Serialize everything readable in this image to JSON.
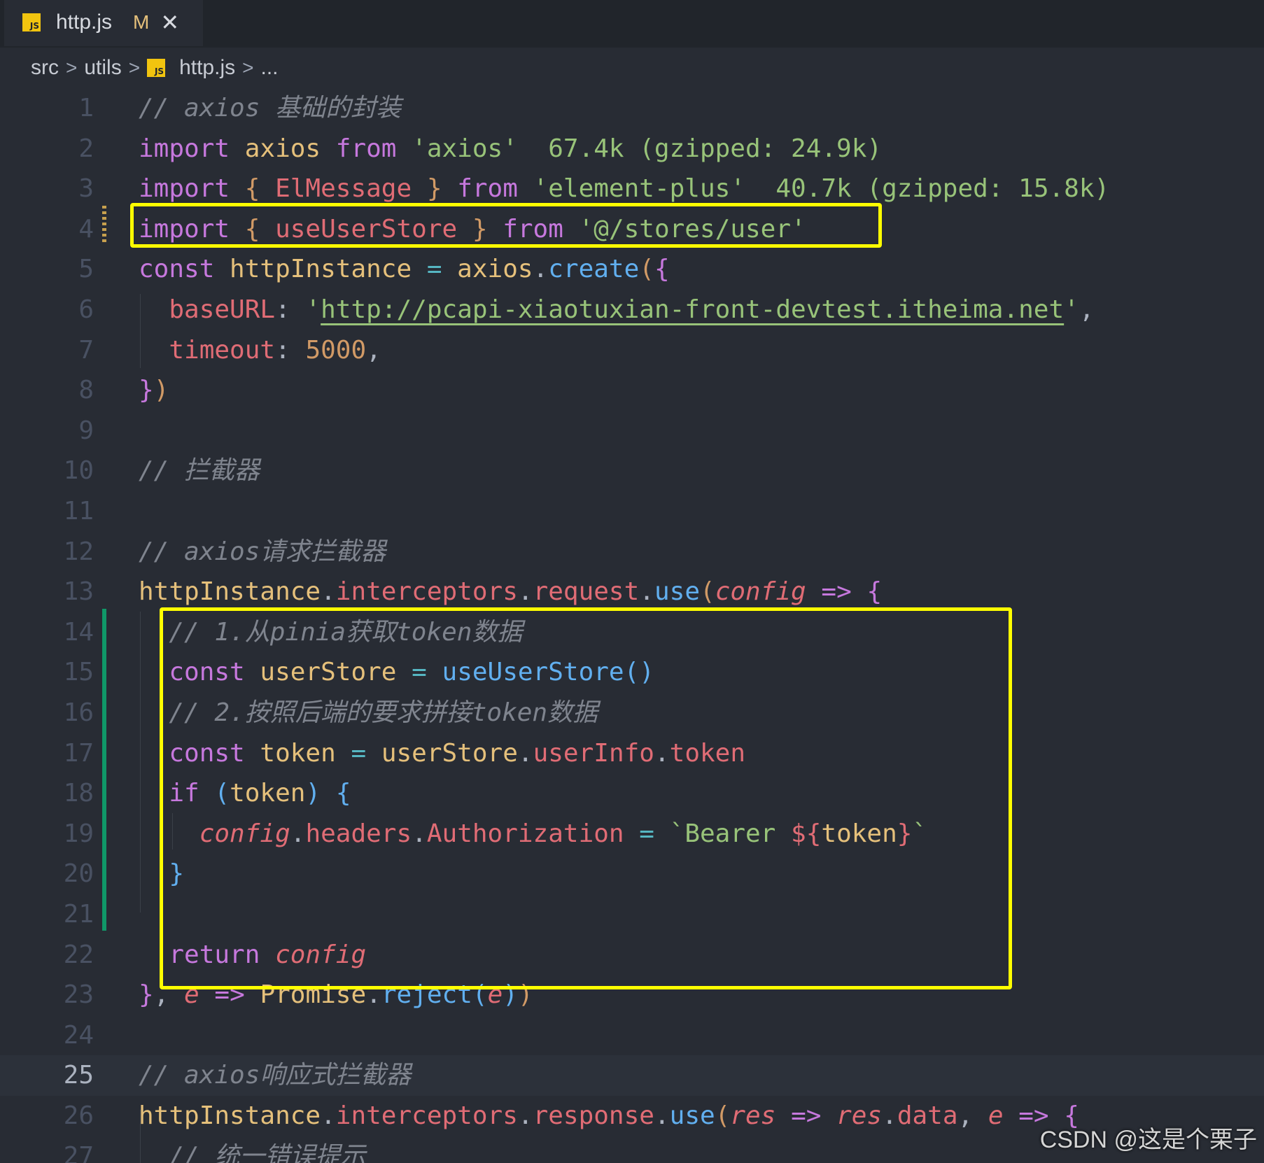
{
  "tab": {
    "icon": "js-file-icon",
    "icon_label": "JS",
    "filename": "http.js",
    "status": "M",
    "close_glyph": "✕"
  },
  "breadcrumb": {
    "items": [
      "src",
      "utils",
      "http.js",
      "..."
    ],
    "separator": ">",
    "file_icon_label": "JS"
  },
  "editor": {
    "current_line": 25,
    "lines": [
      {
        "n": "1",
        "tokens": [
          [
            "cm",
            "// axios 基础的封装"
          ]
        ]
      },
      {
        "n": "2",
        "tokens": [
          [
            "kw",
            "import "
          ],
          [
            "var",
            "axios "
          ],
          [
            "kw",
            "from "
          ],
          [
            "str",
            "'axios'"
          ],
          [
            "pl",
            "  "
          ],
          [
            "hint",
            "67.4k (gzipped: 24.9k)"
          ]
        ]
      },
      {
        "n": "3",
        "tokens": [
          [
            "kw",
            "import "
          ],
          [
            "p2",
            "{ "
          ],
          [
            "prop",
            "ElMessage "
          ],
          [
            "p2",
            "} "
          ],
          [
            "kw",
            "from "
          ],
          [
            "str",
            "'element-plus'"
          ],
          [
            "pl",
            "  "
          ],
          [
            "hint",
            "40.7k (gzipped: 15.8k)"
          ]
        ]
      },
      {
        "n": "4",
        "tokens": [
          [
            "kw",
            "import "
          ],
          [
            "p2",
            "{ "
          ],
          [
            "prop",
            "useUserStore "
          ],
          [
            "p2",
            "} "
          ],
          [
            "kw",
            "from "
          ],
          [
            "str",
            "'@/stores/user'"
          ]
        ]
      },
      {
        "n": "5",
        "tokens": [
          [
            "kw",
            "const "
          ],
          [
            "var",
            "httpInstance "
          ],
          [
            "op",
            "= "
          ],
          [
            "var",
            "axios"
          ],
          [
            "pl",
            "."
          ],
          [
            "fn",
            "create"
          ],
          [
            "p2",
            "("
          ],
          [
            "p1",
            "{"
          ]
        ]
      },
      {
        "n": "6",
        "tokens": [
          [
            "pl",
            "  "
          ],
          [
            "prop",
            "baseURL"
          ],
          [
            "pl",
            ": "
          ],
          [
            "str",
            "'"
          ],
          [
            "link",
            "http://pcapi-xiaotuxian-front-devtest.itheima.net"
          ],
          [
            "str",
            "'"
          ],
          [
            "pl",
            ","
          ]
        ]
      },
      {
        "n": "7",
        "tokens": [
          [
            "pl",
            "  "
          ],
          [
            "prop",
            "timeout"
          ],
          [
            "pl",
            ": "
          ],
          [
            "num",
            "5000"
          ],
          [
            "pl",
            ","
          ]
        ]
      },
      {
        "n": "8",
        "tokens": [
          [
            "p1",
            "}"
          ],
          [
            "p2",
            ")"
          ]
        ]
      },
      {
        "n": "9",
        "tokens": []
      },
      {
        "n": "10",
        "tokens": [
          [
            "cm",
            "// 拦截器"
          ]
        ]
      },
      {
        "n": "11",
        "tokens": []
      },
      {
        "n": "12",
        "tokens": [
          [
            "cm",
            "// axios请求拦截器"
          ]
        ]
      },
      {
        "n": "13",
        "tokens": [
          [
            "var",
            "httpInstance"
          ],
          [
            "pl",
            "."
          ],
          [
            "prop",
            "interceptors"
          ],
          [
            "pl",
            "."
          ],
          [
            "prop",
            "request"
          ],
          [
            "pl",
            "."
          ],
          [
            "fn",
            "use"
          ],
          [
            "p2",
            "("
          ],
          [
            "it",
            "config "
          ],
          [
            "kw",
            "=> "
          ],
          [
            "p1",
            "{"
          ]
        ]
      },
      {
        "n": "14",
        "tokens": [
          [
            "pl",
            "  "
          ],
          [
            "cm",
            "// 1.从pinia获取token数据"
          ]
        ]
      },
      {
        "n": "15",
        "tokens": [
          [
            "pl",
            "  "
          ],
          [
            "kw",
            "const "
          ],
          [
            "var",
            "userStore "
          ],
          [
            "op",
            "= "
          ],
          [
            "fn",
            "useUserStore"
          ],
          [
            "p3",
            "()"
          ]
        ]
      },
      {
        "n": "16",
        "tokens": [
          [
            "pl",
            "  "
          ],
          [
            "cm",
            "// 2.按照后端的要求拼接token数据"
          ]
        ]
      },
      {
        "n": "17",
        "tokens": [
          [
            "pl",
            "  "
          ],
          [
            "kw",
            "const "
          ],
          [
            "var",
            "token "
          ],
          [
            "op",
            "= "
          ],
          [
            "var",
            "userStore"
          ],
          [
            "pl",
            "."
          ],
          [
            "prop",
            "userInfo"
          ],
          [
            "pl",
            "."
          ],
          [
            "prop",
            "token"
          ]
        ]
      },
      {
        "n": "18",
        "tokens": [
          [
            "pl",
            "  "
          ],
          [
            "kw",
            "if "
          ],
          [
            "p3",
            "("
          ],
          [
            "var",
            "token"
          ],
          [
            "p3",
            ") "
          ],
          [
            "p3",
            "{"
          ]
        ]
      },
      {
        "n": "19",
        "tokens": [
          [
            "pl",
            "    "
          ],
          [
            "it",
            "config"
          ],
          [
            "pl",
            "."
          ],
          [
            "prop",
            "headers"
          ],
          [
            "pl",
            "."
          ],
          [
            "prop",
            "Authorization "
          ],
          [
            "op",
            "= "
          ],
          [
            "str",
            "`Bearer "
          ],
          [
            "prop",
            "${"
          ],
          [
            "var",
            "token"
          ],
          [
            "prop",
            "}"
          ],
          [
            "str",
            "`"
          ]
        ]
      },
      {
        "n": "20",
        "tokens": [
          [
            "pl",
            "  "
          ],
          [
            "p3",
            "}"
          ]
        ]
      },
      {
        "n": "21",
        "tokens": []
      },
      {
        "n": "22",
        "tokens": [
          [
            "pl",
            "  "
          ],
          [
            "kw",
            "return "
          ],
          [
            "it",
            "config"
          ]
        ]
      },
      {
        "n": "23",
        "tokens": [
          [
            "p1",
            "}"
          ],
          [
            "pl",
            ", "
          ],
          [
            "it",
            "e "
          ],
          [
            "kw",
            "=> "
          ],
          [
            "var",
            "Promise"
          ],
          [
            "pl",
            "."
          ],
          [
            "fn",
            "reject"
          ],
          [
            "p3",
            "("
          ],
          [
            "it",
            "e"
          ],
          [
            "p3",
            ")"
          ],
          [
            "p2",
            ")"
          ]
        ]
      },
      {
        "n": "24",
        "tokens": []
      },
      {
        "n": "25",
        "tokens": [
          [
            "cm",
            "// axios响应式拦截器"
          ]
        ]
      },
      {
        "n": "26",
        "tokens": [
          [
            "var",
            "httpInstance"
          ],
          [
            "pl",
            "."
          ],
          [
            "prop",
            "interceptors"
          ],
          [
            "pl",
            "."
          ],
          [
            "prop",
            "response"
          ],
          [
            "pl",
            "."
          ],
          [
            "fn",
            "use"
          ],
          [
            "p2",
            "("
          ],
          [
            "it",
            "res "
          ],
          [
            "kw",
            "=> "
          ],
          [
            "it",
            "res"
          ],
          [
            "pl",
            "."
          ],
          [
            "prop",
            "data"
          ],
          [
            "pl",
            ", "
          ],
          [
            "it",
            "e "
          ],
          [
            "kw",
            "=> "
          ],
          [
            "p1",
            "{"
          ]
        ]
      },
      {
        "n": "27",
        "tokens": [
          [
            "pl",
            "  "
          ],
          [
            "cm",
            "// 统一错误提示"
          ]
        ]
      }
    ]
  },
  "watermark": "CSDN @这是个栗子",
  "colors": {
    "background": "#282c34",
    "annotation": "#ffff00",
    "git_added": "#109868",
    "keyword": "#c678dd",
    "string": "#98c379",
    "function": "#61afef"
  }
}
